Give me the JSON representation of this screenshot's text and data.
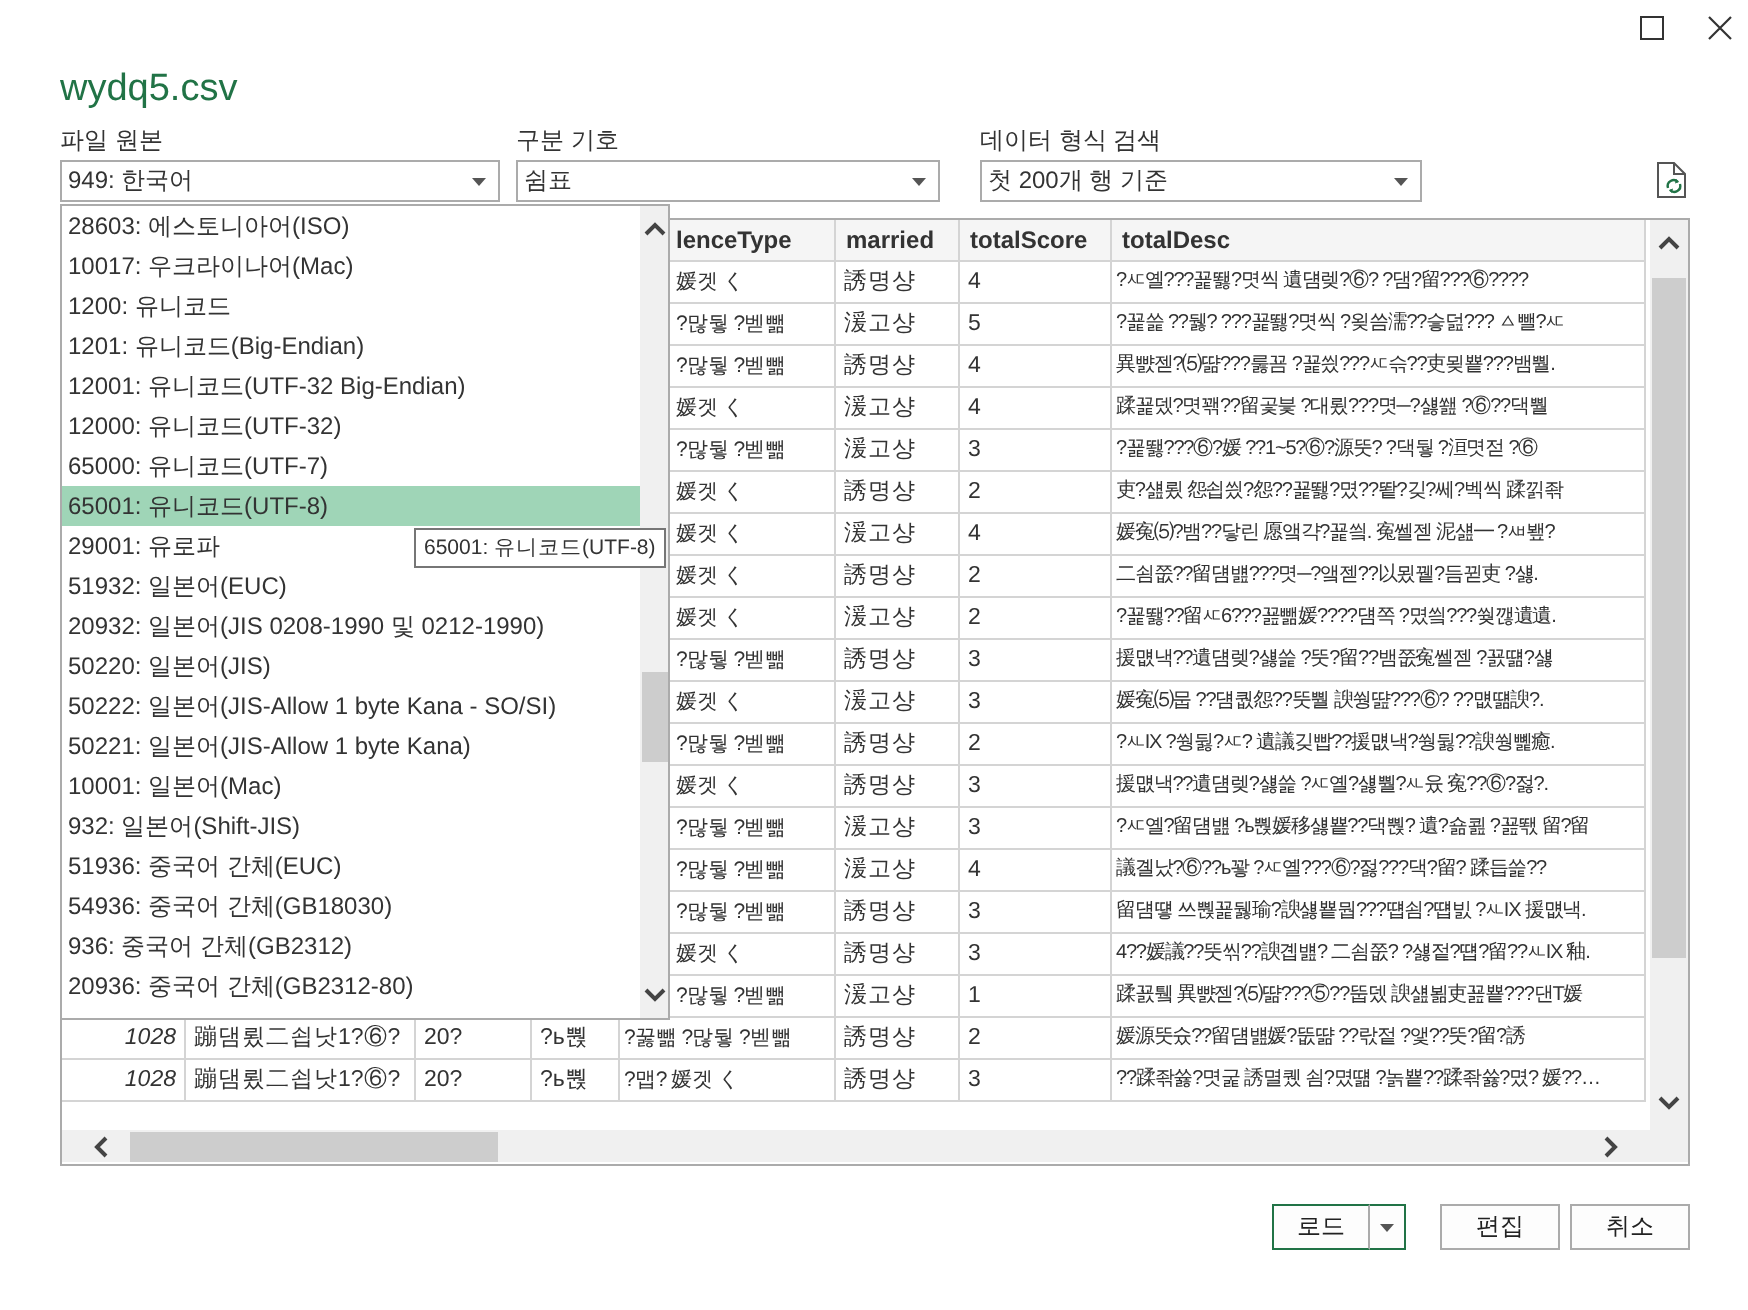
{
  "window": {
    "title": "wydq5.csv"
  },
  "fields": [
    {
      "label": "파일 원본",
      "value": "949: 한국어"
    },
    {
      "label": "구분 기호",
      "value": "쉼표"
    },
    {
      "label": "데이터 형식 검색",
      "value": "첫 200개 행 기준"
    }
  ],
  "table": {
    "columns": [
      {},
      {},
      {},
      {},
      {
        "label": "lenceType"
      },
      {
        "label": "married"
      },
      {
        "label": "totalScore"
      },
      {
        "label": "totalDesc"
      }
    ],
    "rows": [
      [
        null,
        null,
        null,
        null,
        "媛겟 く",
        "誘명샹",
        "4",
        "?ㅼ옐???꾩뙗?몃씩 遺덈렞?⑥? ?댐?留???⑥????"
      ],
      [
        null,
        null,
        null,
        null,
        "?많뒇 ?벧뺆",
        "湲고샹",
        "5",
        "?꾩쓽 ??뒗? ???꾩뙗?몃씩 ?욎씀濡??슿덢??? ㅿ뺄?ㅼ"
      ],
      [
        null,
        null,
        null,
        null,
        "?많뒇 ?벧뺆",
        "誘명샹",
        "4",
        "異뺤젣?⑸땲???룷꾬 ?꾩씠???ㅼ슦??吏묒뿉???뱀뿰."
      ],
      [
        null,
        null,
        null,
        null,
        "媛겟 く",
        "湲고샹",
        "4",
        "蹂꾩뎄?몃꽦??留곷븣 ?대룄???몃─?섏쐞 ?⑥??댁뿰"
      ],
      [
        null,
        null,
        null,
        null,
        "?많뒇 ?벧뺆",
        "湲고샹",
        "3",
        "?꾩뙗???⑥?媛 ??1~5?⑥?源뚯? ?댁뒇 ?洹몃젇 ?⑥"
      ],
      [
        null,
        null,
        null,
        null,
        "媛겟 く",
        "誘명샹",
        "2",
        "吏?섎룄 怨쇱씠?怨??꾩뙗?몄??뙅?깆?쎄?벡씩 蹂낅좎"
      ],
      [
        null,
        null,
        null,
        null,
        "媛겟 く",
        "湲고샹",
        "4",
        "媛寃⑸?뱀??닿린 愿앸갹?꾩씤. 寃쎌젣 泥섎━ ?ㅽ뵆?"
      ],
      [
        null,
        null,
        null,
        null,
        "媛겟 く",
        "誘명샹",
        "2",
        "二쇰쭚??留덈뱶???몃─?앸젣??以묐뀉?듬뀓吏 ?섏."
      ],
      [
        null,
        null,
        null,
        null,
        "媛겟 く",
        "湲고샹",
        "2",
        "?꾩뙗??留ㅼ6???꾪뺆媛????덈쪽 ?몄씤???쒖깮遺遺."
      ],
      [
        null,
        null,
        null,
        null,
        "?많뒇 ?벧뺆",
        "誘명샹",
        "3",
        "援먮낵??遺덈렞?섏쓽 ?뚯?留??뱀쭚寃쎌젣 ?꾨떎?섏"
      ],
      [
        null,
        null,
        null,
        null,
        "媛겟 く",
        "湲고샹",
        "3",
        "媛寃⑸뭅 ??덈퀎怨??뚯뿰 諛쒕땶???⑥? ??먮떎諛?."
      ],
      [
        null,
        null,
        null,
        null,
        "?많뒇 ?벧뺆",
        "誘명샹",
        "2",
        "?ㅻIX ?쒕뒳?ㅼ? 遺議깆빱??援먮낵?쒕뒳??諛쒕뼱癒."
      ],
      [
        null,
        null,
        null,
        null,
        "媛겟 く",
        "誘명샹",
        "3",
        "援먮낵??遺덈렞?섏쓽 ?ㅼ옐?섏뿰?ㅻ윴 寃??⑥?젏?."
      ],
      [
        null,
        null,
        null,
        null,
        "?많뒇 ?벧뺆",
        "湲고샹",
        "3",
        "?ㅼ옐?留덈뱶 ?ь뿭媛移섏뿉??댁뿭? 遺?숆쾶 ?꾪뙋 留?留"
      ],
      [
        null,
        null,
        null,
        null,
        "?많뒇 ?벧뺆",
        "湲고샹",
        "4",
        "議곌났?⑥??ь꽣 ?ㅼ옐???⑥?젏???댁?留? 蹂듭쓽??"
      ],
      [
        null,
        null,
        null,
        null,
        "?많뒇 ?벧뺆",
        "誘명샹",
        "3",
        "留덈떟 쓰뿭꾩뒗瑜?諛섏뿉뭡???떕쇰?떕빐 ?ㅻIX 援먮낵."
      ],
      [
        null,
        null,
        null,
        null,
        "媛겟 く",
        "誘명샹",
        "3",
        "4??媛議??뚯씪??諛곕뱶? 二쇰쭚? ?섏젙?떕?留??ㅻIX 釉."
      ],
      [
        null,
        null,
        null,
        null,
        "?많뒇 ?벧뺆",
        "湲고샹",
        "1",
        "蹂꾨퉼 異뺤젣?⑸땲???⑤??뚭뎄 諛섎뵒吏꾪뿉???댄T媛"
      ],
      [
        "1028",
        "蹦댐룄二쇱낫1?⑥?",
        "20?",
        "?ь뿭",
        "?꿇뺆 ?많뒇 ?벧뺆",
        "誘명샹",
        "2",
        "媛源뚯슜??留덈뱶媛?뚮땲 ??띿젙 ?앷??뚯?留?誘"
      ],
      [
        "1028",
        "蹦댐룄二쇱낫1?⑥?",
        "20?",
        "?ь뿭",
        "?맵? 媛겟 く",
        "誘명샹",
        "3",
        "??蹂좎쓣?몃굹 誘멸퀬 쇰?몄떎 ?놁뿉??蹂좎쓣?몄? 媛??…"
      ]
    ]
  },
  "encoding_list": {
    "items": [
      {
        "label": "28603: 에스토니아어(ISO)",
        "selected": false
      },
      {
        "label": "10017: 우크라이나어(Mac)",
        "selected": false
      },
      {
        "label": "1200: 유니코드",
        "selected": false
      },
      {
        "label": "1201: 유니코드(Big-Endian)",
        "selected": false
      },
      {
        "label": "12001: 유니코드(UTF-32 Big-Endian)",
        "selected": false
      },
      {
        "label": "12000: 유니코드(UTF-32)",
        "selected": false
      },
      {
        "label": "65000: 유니코드(UTF-7)",
        "selected": false
      },
      {
        "label": "65001: 유니코드(UTF-8)",
        "selected": true
      },
      {
        "label": "29001: 유로파",
        "selected": false
      },
      {
        "label": "51932: 일본어(EUC)",
        "selected": false
      },
      {
        "label": "20932: 일본어(JIS 0208-1990 및 0212-1990)",
        "selected": false
      },
      {
        "label": "50220: 일본어(JIS)",
        "selected": false
      },
      {
        "label": "50222: 일본어(JIS-Allow 1 byte Kana - SO/SI)",
        "selected": false
      },
      {
        "label": "50221: 일본어(JIS-Allow 1 byte Kana)",
        "selected": false
      },
      {
        "label": "10001: 일본어(Mac)",
        "selected": false
      },
      {
        "label": "932: 일본어(Shift-JIS)",
        "selected": false
      },
      {
        "label": "51936: 중국어 간체(EUC)",
        "selected": false
      },
      {
        "label": "54936: 중국어 간체(GB18030)",
        "selected": false
      },
      {
        "label": "936: 중국어 간체(GB2312)",
        "selected": false
      },
      {
        "label": "20936: 중국어 간체(GB2312-80)",
        "selected": false
      }
    ]
  },
  "tooltip": "65001: 유니코드(UTF-8)",
  "buttons": [
    {
      "label": "로드",
      "kind": "split"
    },
    {
      "label": "편집",
      "kind": "plain"
    },
    {
      "label": "취소",
      "kind": "plain"
    }
  ]
}
